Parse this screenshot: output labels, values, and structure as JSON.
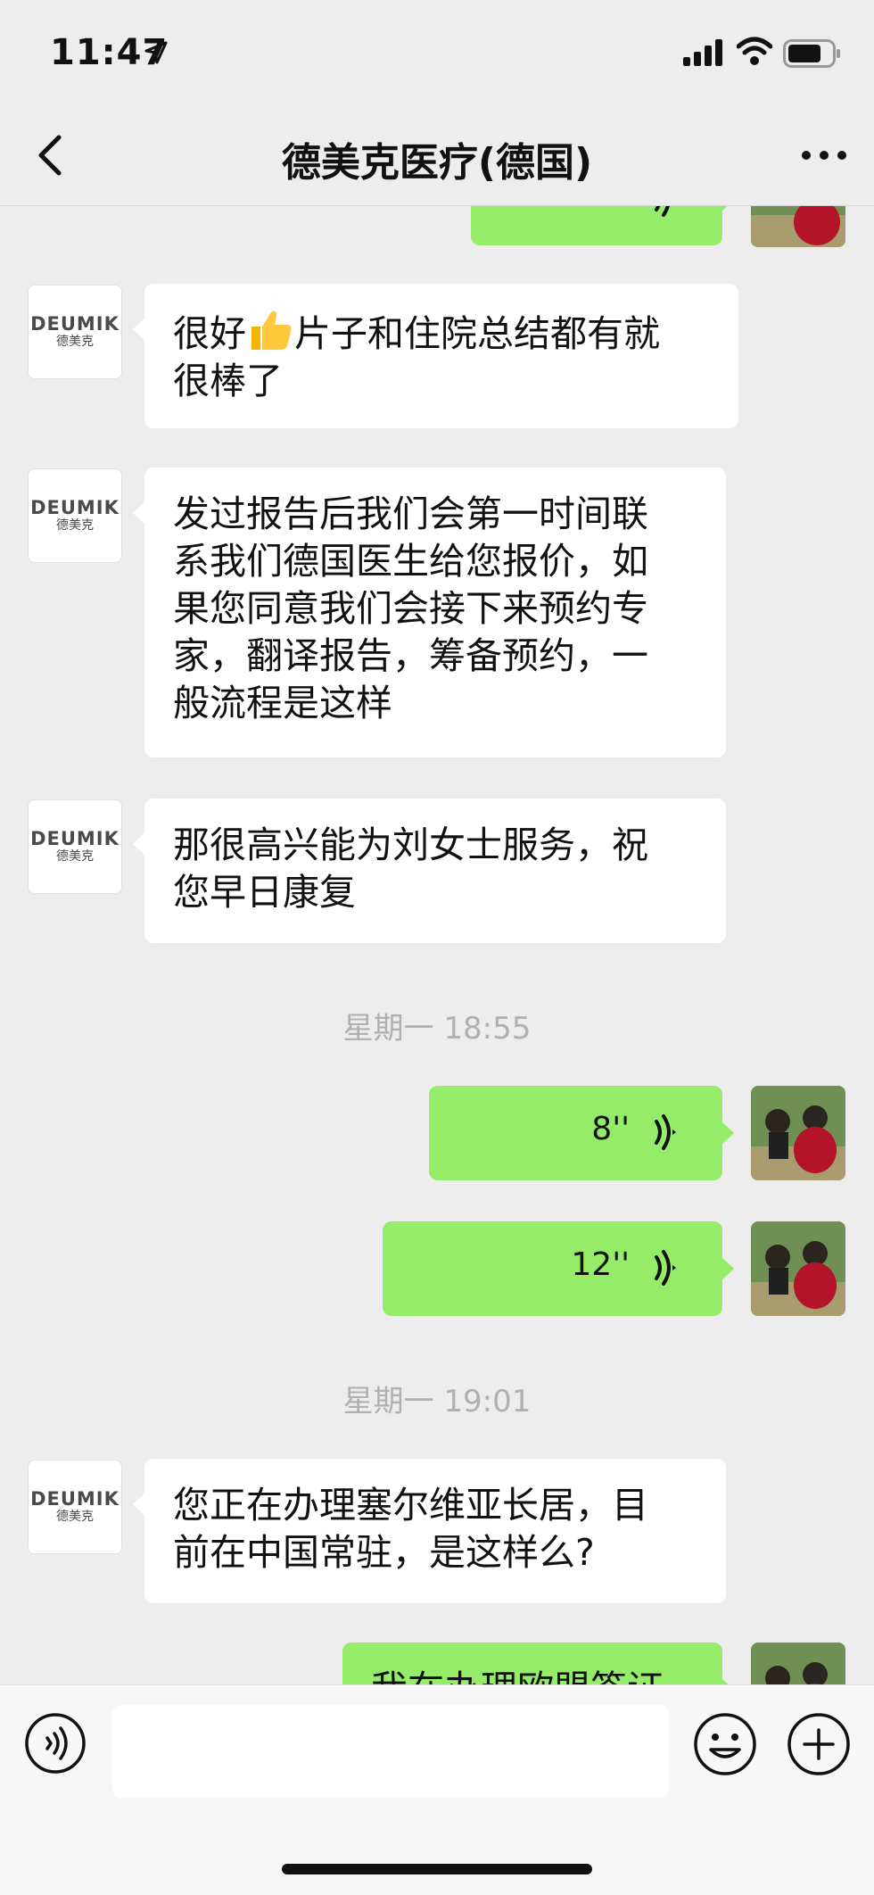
{
  "status_bar": {
    "time": "11:47"
  },
  "nav": {
    "title": "德美克医疗(德国)"
  },
  "brand": {
    "logo_text": "DEUMIK",
    "logo_sub": "德美克"
  },
  "messages": {
    "m1": {
      "line1a": "很好",
      "line1b": "片子和住院总结都有就",
      "line2": "很棒了"
    },
    "m2": {
      "lines": [
        "发过报告后我们会第一时间联",
        "系我们德国医生给您报价，如",
        "果您同意我们会接下来预约专",
        "家，翻译报告，筹备预约，一",
        "般流程是这样"
      ]
    },
    "m3": {
      "lines": [
        "那很高兴能为刘女士服务，祝",
        "您早日康复"
      ]
    },
    "ts1": "星期一 18:55",
    "v1": {
      "duration": "8''"
    },
    "v2": {
      "duration": "12''"
    },
    "ts2": "星期一 19:01",
    "m4": {
      "lines": [
        "您正在办理塞尔维亚长居，目",
        "前在中国常驻，是这样么?"
      ]
    },
    "m5_partial": "我在办理欧盟签证"
  },
  "colors": {
    "sent_bubble": "#95ec69",
    "received_bubble": "#ffffff",
    "background": "#ededed"
  },
  "icons": [
    "location-arrow-icon",
    "signal-icon",
    "wifi-icon",
    "battery-icon",
    "back-chevron-icon",
    "more-dots-icon",
    "voice-wave-icon",
    "voice-input-icon",
    "emoji-icon",
    "plus-icon"
  ]
}
